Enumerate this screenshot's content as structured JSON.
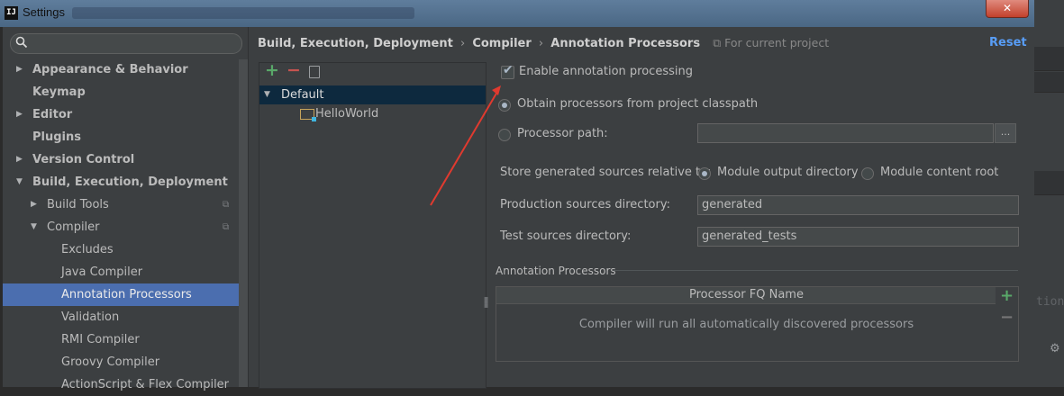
{
  "window": {
    "title": "Settings",
    "app_icon_text": "IJ",
    "close_glyph": "✕"
  },
  "search": {
    "placeholder": "",
    "icon": "search-icon"
  },
  "nav": {
    "items": [
      {
        "label": "Appearance & Behavior",
        "bold": true,
        "arrow": "▶"
      },
      {
        "label": "Keymap",
        "bold": true,
        "arrow": ""
      },
      {
        "label": "Editor",
        "bold": true,
        "arrow": "▶"
      },
      {
        "label": "Plugins",
        "bold": true,
        "arrow": ""
      },
      {
        "label": "Version Control",
        "bold": true,
        "arrow": "▶"
      },
      {
        "label": "Build, Execution, Deployment",
        "bold": true,
        "arrow": "▼"
      },
      {
        "label": "Build Tools",
        "bold": false,
        "arrow": "▶"
      },
      {
        "label": "Compiler",
        "bold": false,
        "arrow": "▼"
      },
      {
        "label": "Excludes",
        "bold": false,
        "arrow": ""
      },
      {
        "label": "Java Compiler",
        "bold": false,
        "arrow": ""
      },
      {
        "label": "Annotation Processors",
        "bold": false,
        "arrow": "",
        "selected": true
      },
      {
        "label": "Validation",
        "bold": false,
        "arrow": ""
      },
      {
        "label": "RMI Compiler",
        "bold": false,
        "arrow": ""
      },
      {
        "label": "Groovy Compiler",
        "bold": false,
        "arrow": ""
      },
      {
        "label": "ActionScript & Flex Compiler",
        "bold": false,
        "arrow": ""
      }
    ]
  },
  "breadcrumb": {
    "parts": [
      "Build, Execution, Deployment",
      "Compiler",
      "Annotation Processors"
    ],
    "separator": "›",
    "note": "For current project",
    "note_icon": "project-scope-icon"
  },
  "reset_label": "Reset",
  "profiles": {
    "add_glyph": "+",
    "remove_glyph": "−",
    "items": [
      {
        "label": "Default",
        "arrow": "▼",
        "selected": true
      },
      {
        "label": "HelloWorld",
        "arrow": ""
      }
    ]
  },
  "options": {
    "enable_label": "Enable annotation processing",
    "enable_checked": true,
    "check_glyph": "✔",
    "obtain_label": "Obtain processors from project classpath",
    "obtain_selected": true,
    "processor_path_label": "Processor path:",
    "processor_path_value": "",
    "browse_label": "...",
    "store_label": "Store generated sources relative to:",
    "module_output_label": "Module output directory",
    "module_output_selected": true,
    "module_content_label": "Module content root",
    "module_content_selected": false,
    "production_label": "Production sources directory:",
    "production_value": "generated",
    "test_label": "Test sources directory:",
    "test_value": "generated_tests"
  },
  "processors": {
    "section_title": "Annotation Processors",
    "column_header": "Processor FQ Name",
    "empty_text": "Compiler will run all automatically discovered processors",
    "add_glyph": "+",
    "remove_glyph": "−"
  },
  "background_fragment": {
    "code_text": "tion"
  },
  "colors": {
    "accent": "#589df6",
    "selection": "#4b6eaf",
    "arrow": "#e03a2f",
    "add": "#59a869",
    "remove": "#c75450"
  }
}
